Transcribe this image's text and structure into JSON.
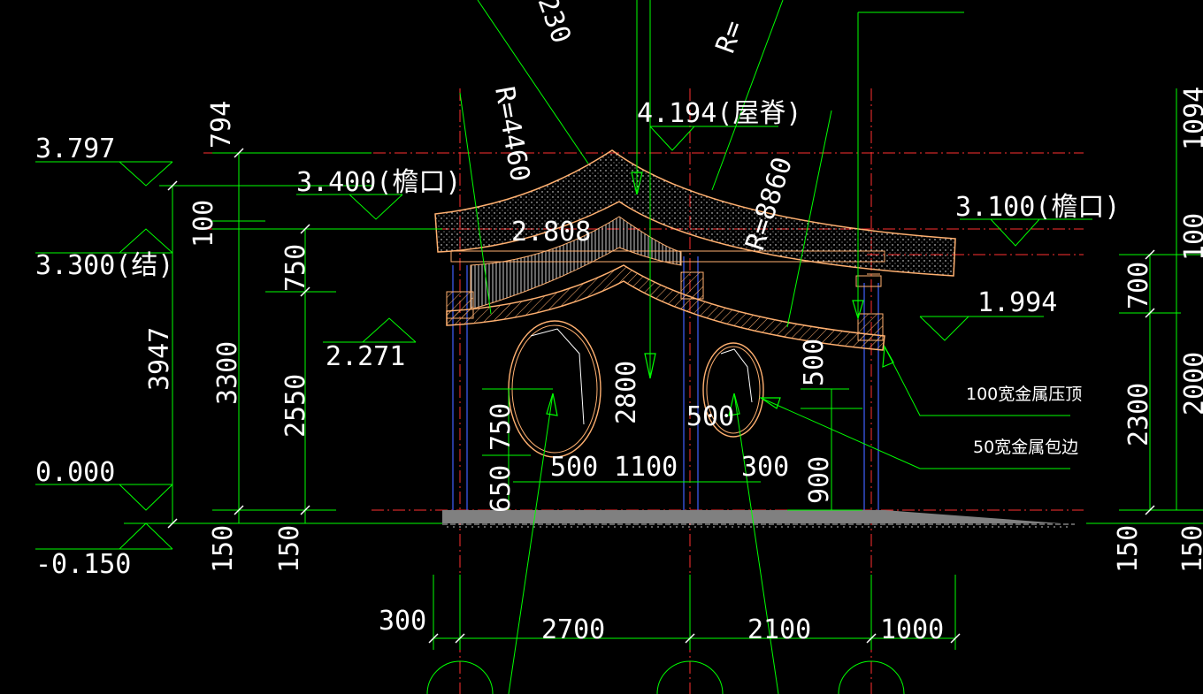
{
  "colors": {
    "background": "#000000",
    "dimension": "#00ff00",
    "text_white": "#ffffff",
    "axis_red": "#ff3030",
    "outline_orange": "#ffb070",
    "column_blue": "#4060ff",
    "ground_grey": "#808080"
  },
  "elevations": {
    "e3797": "3.797",
    "e3400": "3.400(檐口)",
    "e3300": "3.300(结)",
    "e2271": "2.271",
    "e0000": "0.000",
    "em150": "-0.150",
    "e4194": "4.194(屋脊)",
    "e3100": "3.100(檐口)",
    "e1994": "1.994",
    "e2808": "2.808"
  },
  "dimensions": {
    "left": {
      "d794": "794",
      "d100": "100",
      "d750a": "750",
      "d3947": "3947",
      "d3300": "3300",
      "d2550": "2550",
      "d150a": "150",
      "d150b": "150"
    },
    "window": {
      "d750": "750",
      "d650": "650",
      "d500a": "500",
      "d1100": "1100",
      "d2800": "2800",
      "d500b": "500",
      "d300": "300",
      "d500c": "500",
      "d900": "900"
    },
    "right": {
      "d1094": "1094",
      "d100": "100",
      "d700": "700",
      "d2300": "2300",
      "d2000": "2000",
      "d150a": "150",
      "d150b": "150"
    },
    "bottom": {
      "d300": "300",
      "d2700": "2700",
      "d2100": "2100",
      "d1000": "1000"
    },
    "radii": {
      "r230": "230",
      "r_top": "R=",
      "r4460": "R=4460",
      "r8860": "R=8860"
    }
  },
  "notes": {
    "metal_cap": "100宽金属压顶",
    "metal_edge": "50宽金属包边"
  }
}
